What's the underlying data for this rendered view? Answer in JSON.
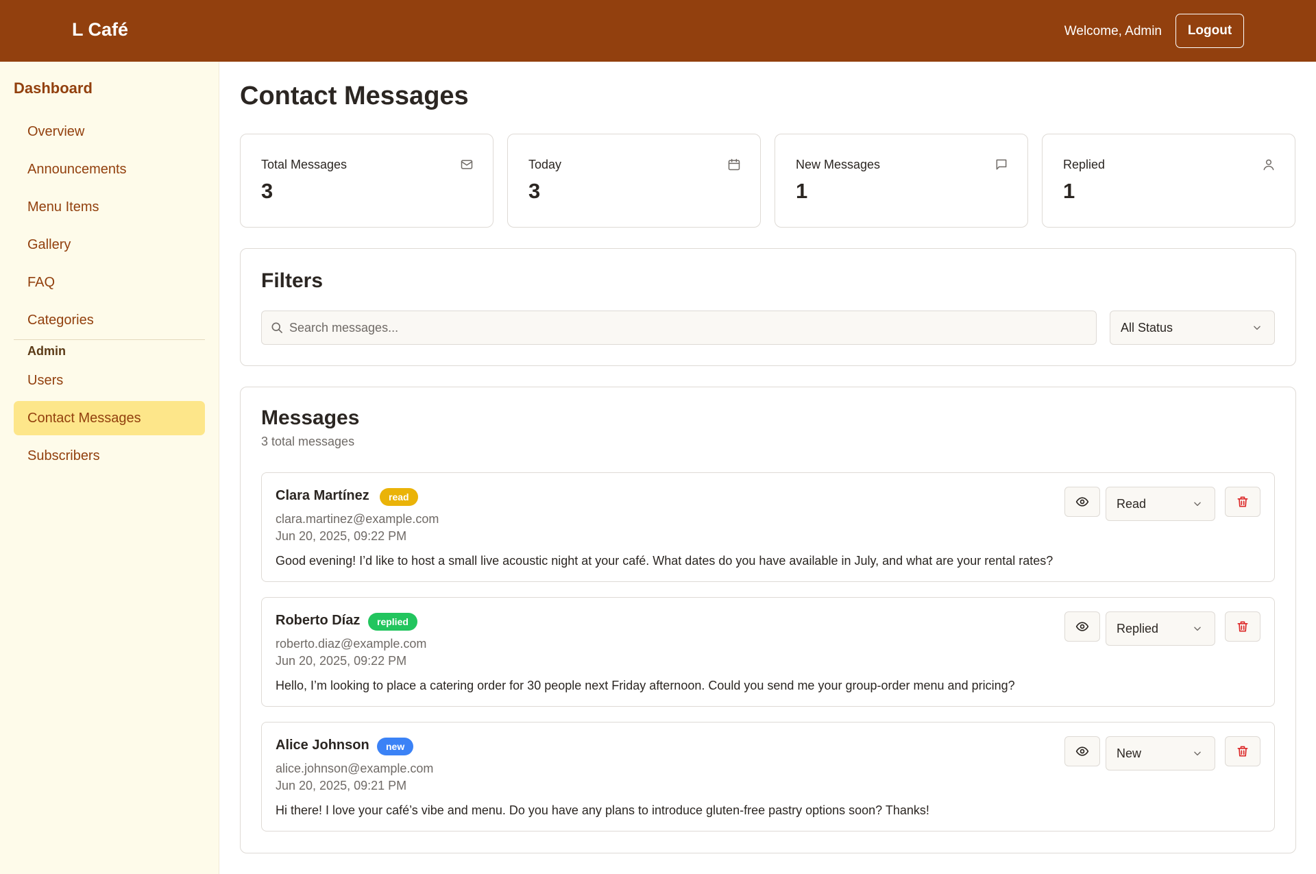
{
  "header": {
    "brand": "L Café",
    "welcome": "Welcome, Admin",
    "logout_label": "Logout",
    "bg_color": "#92400e"
  },
  "sidebar": {
    "heading": "Dashboard",
    "items": [
      {
        "label": "Overview"
      },
      {
        "label": "Announcements"
      },
      {
        "label": "Menu Items"
      },
      {
        "label": "Gallery"
      },
      {
        "label": "FAQ"
      },
      {
        "label": "Categories"
      }
    ],
    "admin_heading": "Admin",
    "admin_items": [
      {
        "label": "Users"
      },
      {
        "label": "Contact Messages",
        "active": true
      },
      {
        "label": "Subscribers"
      }
    ],
    "active_color": "#fde68a"
  },
  "page": {
    "title": "Contact Messages"
  },
  "stats": [
    {
      "label": "Total Messages",
      "value": "3",
      "icon": "mail-icon"
    },
    {
      "label": "Today",
      "value": "3",
      "icon": "calendar-icon"
    },
    {
      "label": "New Messages",
      "value": "1",
      "icon": "message-icon"
    },
    {
      "label": "Replied",
      "value": "1",
      "icon": "user-icon"
    }
  ],
  "filters": {
    "title": "Filters",
    "search_placeholder": "Search messages...",
    "status_value": "All Status"
  },
  "messages": {
    "title": "Messages",
    "subtitle": "3 total messages",
    "items": [
      {
        "name": "Clara Martínez",
        "status": "read",
        "status_color": "#eab308",
        "email": "clara.martinez@example.com",
        "date": "Jun 20, 2025, 09:22 PM",
        "body": "Good evening! I’d like to host a small live acoustic night at your café. What dates do you have available in July, and what are your rental rates?",
        "select_value": "Read"
      },
      {
        "name": "Roberto Díaz",
        "status": "replied",
        "status_color": "#22c55e",
        "email": "roberto.diaz@example.com",
        "date": "Jun 20, 2025, 09:22 PM",
        "body": "Hello, I’m looking to place a catering order for 30 people next Friday afternoon. Could you send me your group-order menu and pricing?",
        "select_value": "Replied"
      },
      {
        "name": "Alice Johnson",
        "status": "new",
        "status_color": "#3b82f6",
        "email": "alice.johnson@example.com",
        "date": "Jun 20, 2025, 09:21 PM",
        "body": "Hi there! I love your café’s vibe and menu. Do you have any plans to introduce gluten-free pastry options soon? Thanks!",
        "select_value": "New"
      }
    ]
  }
}
